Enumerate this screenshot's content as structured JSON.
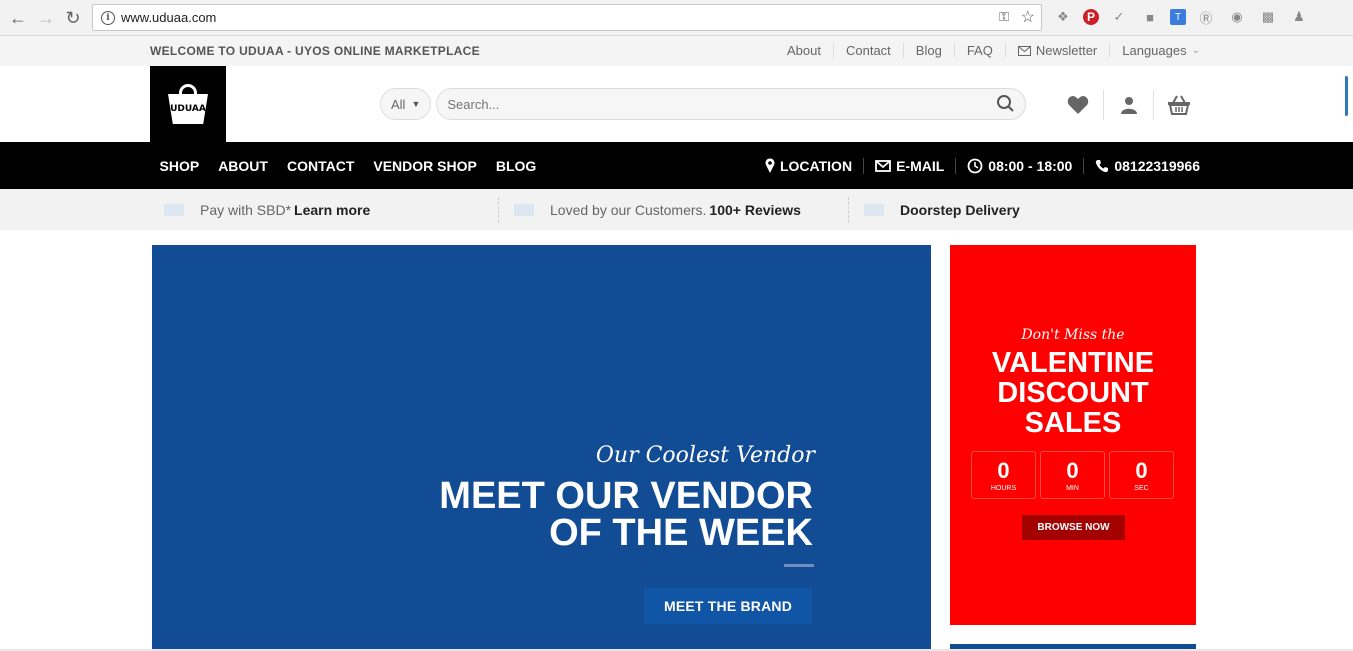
{
  "browser": {
    "url": "www.uduaa.com"
  },
  "topbar": {
    "welcome": "WELCOME TO UDUAA - UYOS ONLINE MARKETPLACE",
    "links": [
      "About",
      "Contact",
      "Blog",
      "FAQ",
      "Newsletter",
      "Languages"
    ]
  },
  "header": {
    "logo_text": "UDUAA",
    "category": "All",
    "search_placeholder": "Search..."
  },
  "nav": {
    "menu": [
      "SHOP",
      "ABOUT",
      "CONTACT",
      "VENDOR SHOP",
      "BLOG"
    ],
    "location": "LOCATION",
    "email": "E-MAIL",
    "hours": "08:00 - 18:00",
    "phone": "08122319966"
  },
  "features": {
    "f1_text": "Pay with SBD*",
    "f1_link": "Learn more",
    "f2_text": "Loved by our Customers.",
    "f2_bold": "100+ Reviews",
    "f3_bold": "Doorstep Delivery"
  },
  "hero": {
    "script": "Our Coolest Vendor",
    "line1": "MEET OUR VENDOR",
    "line2": "OF THE WEEK",
    "cta": "MEET THE BRAND",
    "bg_color": "#124c94"
  },
  "promo": {
    "script": "Don't Miss the",
    "line1": "VALENTINE",
    "line2": "DISCOUNT",
    "line3": "SALES",
    "hours_value": "0",
    "hours_label": "HOURS",
    "min_value": "0",
    "min_label": "MIN",
    "sec_value": "0",
    "sec_label": "SEC",
    "button": "BROWSE NOW",
    "bg_color": "#ff0000"
  }
}
